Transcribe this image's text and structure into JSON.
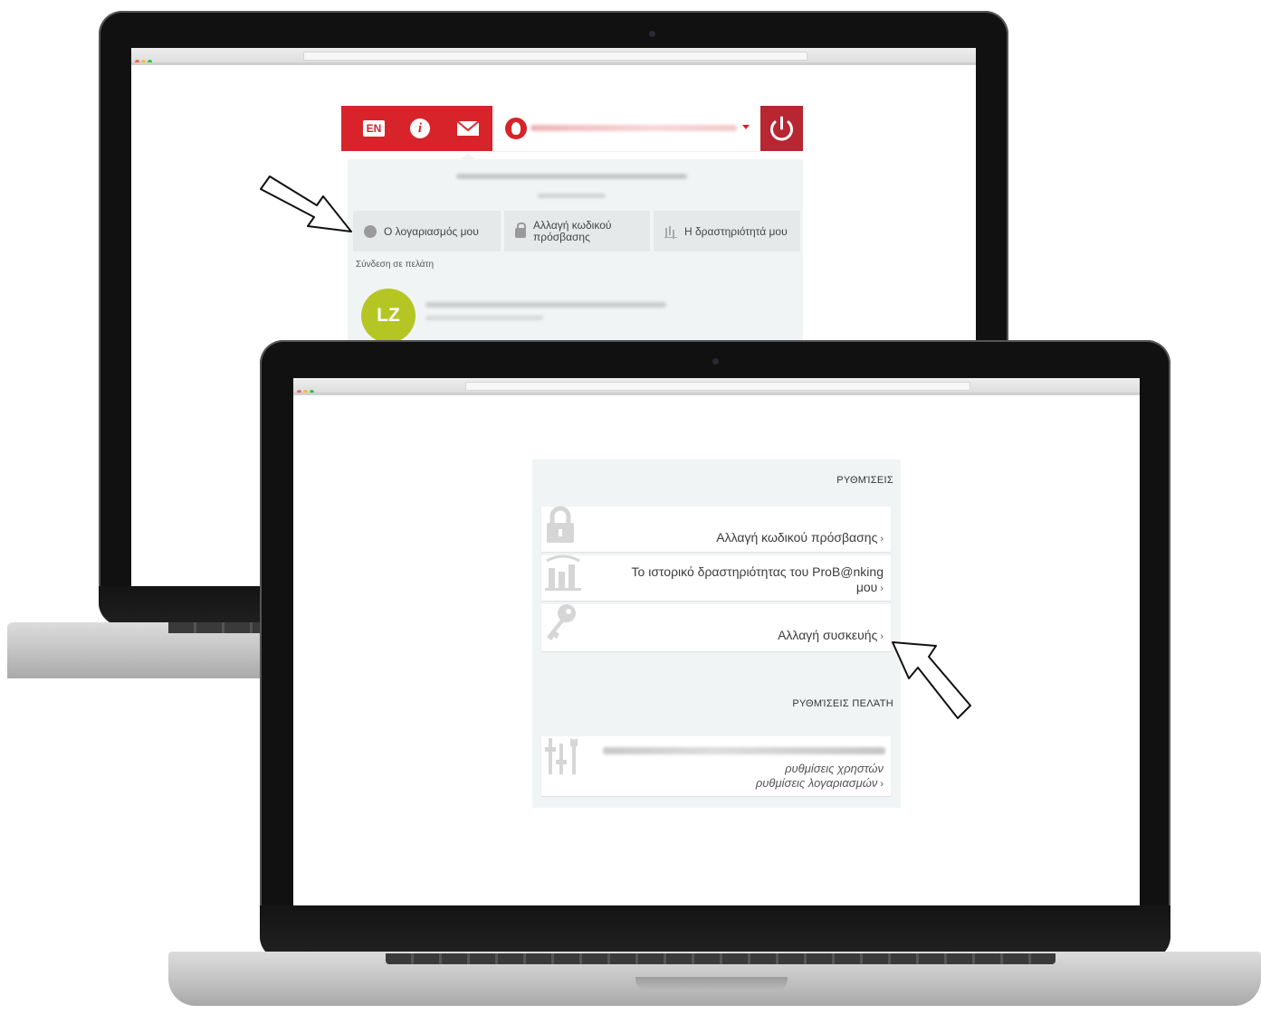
{
  "back_laptop": {
    "topbar": {
      "lang_label": "EN",
      "info_label": "i"
    },
    "dropdown": {
      "buttons": [
        {
          "label": "Ο λογαριασμός μου",
          "icon": "user-icon"
        },
        {
          "label": "Αλλαγή κωδικού\nπρόσβασης",
          "icon": "lock-icon"
        },
        {
          "label": "Η δραστηριότητά μου",
          "icon": "bar-chart-icon"
        }
      ],
      "subheading": "Σύνδεση σε πελάτη",
      "customer_initials": "LZ"
    }
  },
  "front_laptop": {
    "settings_title": "ΡΥΘΜΊΣΕΙΣ",
    "rows": [
      {
        "label": "Αλλαγή κωδικού πρόσβασης",
        "icon": "padlock-icon"
      },
      {
        "label_line1": "Το ιστορικό δραστηριότητας του ProB@nking",
        "label_line2": "μου",
        "icon": "bar-chart-icon"
      },
      {
        "label": "Αλλαγή συσκευής",
        "icon": "key-icon"
      }
    ],
    "customer_settings_title": "ΡΥΘΜΊΣΕΙΣ ΠΕΛΆΤΗ",
    "customer_row": {
      "line1": "ρυθμίσεις χρηστών",
      "line2": "ρυθμίσεις λογαριασμών",
      "icon": "tools-icon"
    }
  },
  "colors": {
    "brand_red": "#d8232a",
    "power_red": "#b72631",
    "avatar_green": "#b5c624",
    "panel_bg": "#f1f4f5"
  }
}
